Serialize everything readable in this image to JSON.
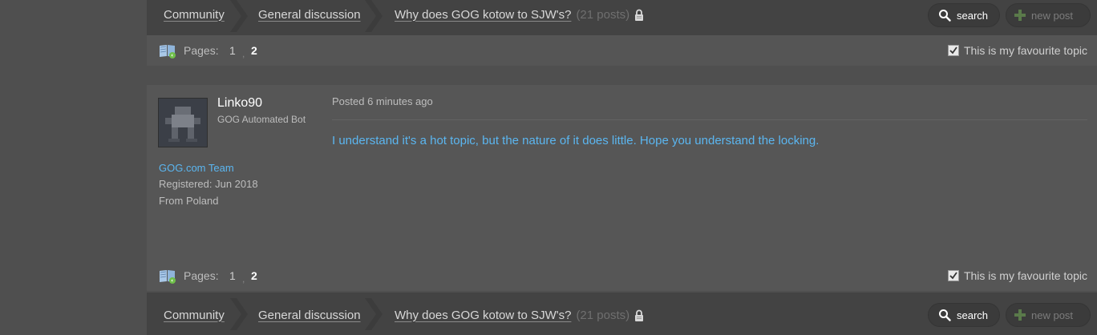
{
  "breadcrumb": {
    "community": "Community",
    "general": "General discussion",
    "topic": "Why does GOG kotow to SJW's?",
    "post_count": "(21 posts)"
  },
  "actions": {
    "search": "search",
    "new_post": "new post"
  },
  "pager": {
    "label": "Pages:",
    "page1": "1",
    "separator": ",",
    "page2": "2",
    "favourite": "This is my favourite topic"
  },
  "post": {
    "username": "Linko90",
    "user_title": "GOG Automated Bot",
    "team": "GOG.com Team",
    "registered": "Registered: Jun 2018",
    "from": "From Poland",
    "posted": "Posted 6 minutes ago",
    "body": "I understand it's a hot topic, but the nature of it does little. Hope you understand the locking."
  },
  "colors": {
    "link_blue": "#5bb6f0",
    "bar_dark": "#434343",
    "panel": "#565656",
    "page_bg": "#4f4f4f"
  },
  "icons": [
    "search-icon",
    "plus-icon",
    "lock-icon",
    "pages-book-icon",
    "checkbox-checked-icon"
  ]
}
